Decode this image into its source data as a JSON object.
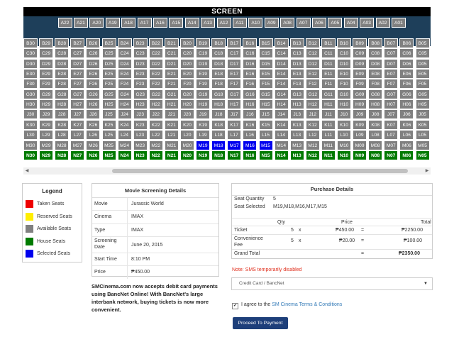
{
  "screen_label": "SCREEN",
  "rows": [
    {
      "letter": "A",
      "from": 22,
      "to": 1,
      "statuses": {}
    },
    {
      "letter": "B",
      "from": 30,
      "to": 5,
      "statuses": {}
    },
    {
      "letter": "C",
      "from": 30,
      "to": 5,
      "statuses": {}
    },
    {
      "letter": "D",
      "from": 30,
      "to": 5,
      "statuses": {}
    },
    {
      "letter": "E",
      "from": 30,
      "to": 5,
      "statuses": {}
    },
    {
      "letter": "F",
      "from": 30,
      "to": 5,
      "statuses": {}
    },
    {
      "letter": "G",
      "from": 30,
      "to": 5,
      "statuses": {}
    },
    {
      "letter": "H",
      "from": 30,
      "to": 5,
      "statuses": {}
    },
    {
      "letter": "J",
      "from": 30,
      "to": 5,
      "statuses": {}
    },
    {
      "letter": "K",
      "from": 30,
      "to": 5,
      "statuses": {}
    },
    {
      "letter": "L",
      "from": 30,
      "to": 5,
      "statuses": {}
    },
    {
      "letter": "M",
      "from": 30,
      "to": 5,
      "statuses": {
        "19": "sel",
        "18": "sel",
        "17": "sel",
        "16": "sel",
        "15": "sel"
      }
    },
    {
      "letter": "N",
      "from": 30,
      "to": 5,
      "default_status": "house",
      "statuses": {}
    }
  ],
  "legend": {
    "title": "Legend",
    "items": [
      {
        "label": "Taken Seats",
        "color": "#ee0000"
      },
      {
        "label": "Reserved Seats",
        "color": "#ffee00"
      },
      {
        "label": "Available Seats",
        "color": "#808080"
      },
      {
        "label": "House Seats",
        "color": "#007a00"
      },
      {
        "label": "Selected Seats",
        "color": "#0000ee"
      }
    ]
  },
  "details": {
    "title": "Movie Screening Details",
    "movie_label": "Movie",
    "movie": "Jurassic World",
    "cinema_label": "Cinema",
    "cinema": "IMAX",
    "type_label": "Type",
    "type": "IMAX",
    "date_label": "Screening Date",
    "date": "June 20, 2015",
    "time_label": "Start Time",
    "time": "8:10 PM",
    "price_label": "Price",
    "price": "₱450.00"
  },
  "promo": "SMCinema.com now accepts debit card payments using BancNet Online! With BancNet's large interbank network, buying tickets is now more convenient.",
  "purchase": {
    "title": "Purchase Details",
    "seat_qty_label": "Seat Quantity",
    "seat_qty": "5",
    "seat_sel_label": "Seat Selected",
    "seat_sel": "M19,M18,M16,M17,M15",
    "col_qty": "Qty",
    "col_price": "Price",
    "col_total": "Total",
    "ticket_label": "Ticket",
    "ticket_qty": "5",
    "ticket_x": "x",
    "ticket_price": "₱450.00",
    "ticket_eq": "=",
    "ticket_total": "₱2250.00",
    "fee_label": "Convenience Fee",
    "fee_qty": "5",
    "fee_x": "x",
    "fee_price": "₱20.00",
    "fee_eq": "=",
    "fee_total": "₱100.00",
    "grand_label": "Grand Total",
    "grand_eq": "=",
    "grand_total": "₱2350.00"
  },
  "sms_note": "Note: SMS temporarily disabled",
  "payment_method": "Credit Card / BancNet",
  "agree_prefix": "I agree to the ",
  "agree_link": "SM Cinema Terms & Conditions",
  "check_mark": "✔",
  "proceed_label": "Proceed To Payment",
  "scroll_left_icon": "◀",
  "scroll_right_icon": "▶",
  "select_caret": "▼"
}
